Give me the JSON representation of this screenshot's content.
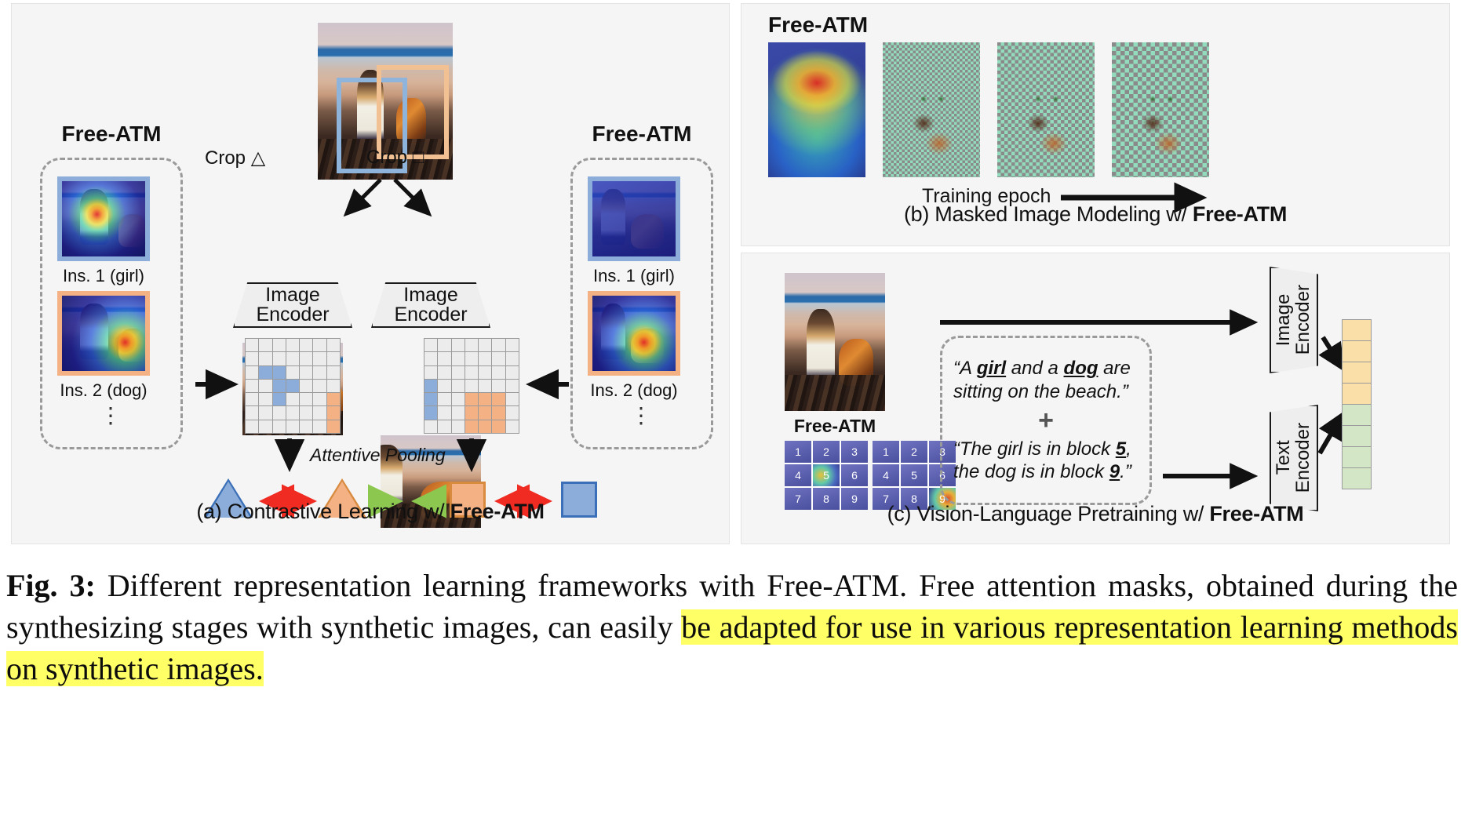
{
  "figure": {
    "caption_label": "Fig. 3:",
    "caption_part1": " Different representation learning frameworks with Free-ATM. Free attention masks, obtained during the synthesizing stages with synthetic images, can easily ",
    "caption_highlight": "be adapted for use in various representation learning methods on synthetic images.",
    "highlight_color": "#ffff66"
  },
  "panel_a": {
    "caption_prefix": "(a) Contrastive Learning w/ ",
    "caption_bold": "Free-ATM",
    "crop_left_label": "Crop △",
    "crop_right_label": "Crop □",
    "encoder_line1": "Image",
    "encoder_line2": "Encoder",
    "pooling_label": "Attentive Pooling",
    "freeatm_title": "Free-ATM",
    "instance_labels": [
      "Ins. 1 (girl)",
      "Ins. 2 (dog)"
    ],
    "ellipsis": "⋮",
    "grid_rows": 7,
    "grid_cols": 7,
    "grid_left_blue_cells": [
      [
        2,
        1
      ],
      [
        2,
        2
      ],
      [
        3,
        2
      ],
      [
        3,
        3
      ],
      [
        4,
        2
      ]
    ],
    "grid_left_orange_cells": [
      [
        4,
        6
      ],
      [
        5,
        6
      ],
      [
        6,
        6
      ]
    ],
    "grid_right_blue_cells": [
      [
        3,
        0
      ],
      [
        4,
        0
      ],
      [
        5,
        0
      ]
    ],
    "grid_right_orange_cells": [
      [
        4,
        3
      ],
      [
        4,
        4
      ],
      [
        4,
        5
      ],
      [
        5,
        3
      ],
      [
        5,
        4
      ],
      [
        5,
        5
      ],
      [
        6,
        3
      ],
      [
        6,
        4
      ],
      [
        6,
        5
      ]
    ],
    "colors": {
      "blue": "#8cadd9",
      "orange": "#f4b183",
      "grid_cell": "#ececec",
      "grid_line": "#9a9a9a"
    },
    "shapes": [
      {
        "type": "triangle",
        "color": "blue"
      },
      {
        "type": "arrow-double",
        "color": "red"
      },
      {
        "type": "triangle",
        "color": "orange"
      },
      {
        "type": "arrow-right",
        "color": "green"
      },
      {
        "type": "arrow-left",
        "color": "green"
      },
      {
        "type": "square",
        "color": "orange"
      },
      {
        "type": "arrow-double",
        "color": "red"
      },
      {
        "type": "square",
        "color": "blue"
      }
    ],
    "arrow_colors": {
      "red": "#ef2b22",
      "green": "#8cc750"
    }
  },
  "panel_b": {
    "caption_prefix": "(b) Masked Image Modeling w/ ",
    "caption_bold": "Free-ATM",
    "freeatm_title": "Free-ATM",
    "epoch_label": "Training epoch",
    "mask_color": "#93dbbd",
    "num_masked_frames": 3
  },
  "panel_c": {
    "caption_prefix": "(c) Vision-Language Pretraining w/ ",
    "caption_bold": "Free-ATM",
    "freeatm_title": "Free-ATM",
    "caption_quote_1_a": "“A ",
    "caption_quote_1_u1": "girl",
    "caption_quote_1_b": " and a ",
    "caption_quote_1_u2": "dog",
    "caption_quote_1_c": " are sitting on the beach.”",
    "plus": "+",
    "caption_quote_2_a": "“The girl is in block ",
    "caption_quote_2_u1": "5",
    "caption_quote_2_b": ", the dog is in block ",
    "caption_quote_2_u2": "9",
    "caption_quote_2_c": ".”",
    "image_encoder_label": "Image\nEncoder",
    "text_encoder_label": "Text\nEncoder",
    "block_numbers": [
      "1",
      "2",
      "3",
      "4",
      "5",
      "6",
      "7",
      "8",
      "9"
    ],
    "highlighted_block_grid1": "5",
    "highlighted_block_grid2": "9",
    "feature_vector": {
      "image_cells": 4,
      "text_cells": 4,
      "image_color": "#fae0a8",
      "text_color": "#d3e6c6"
    }
  }
}
